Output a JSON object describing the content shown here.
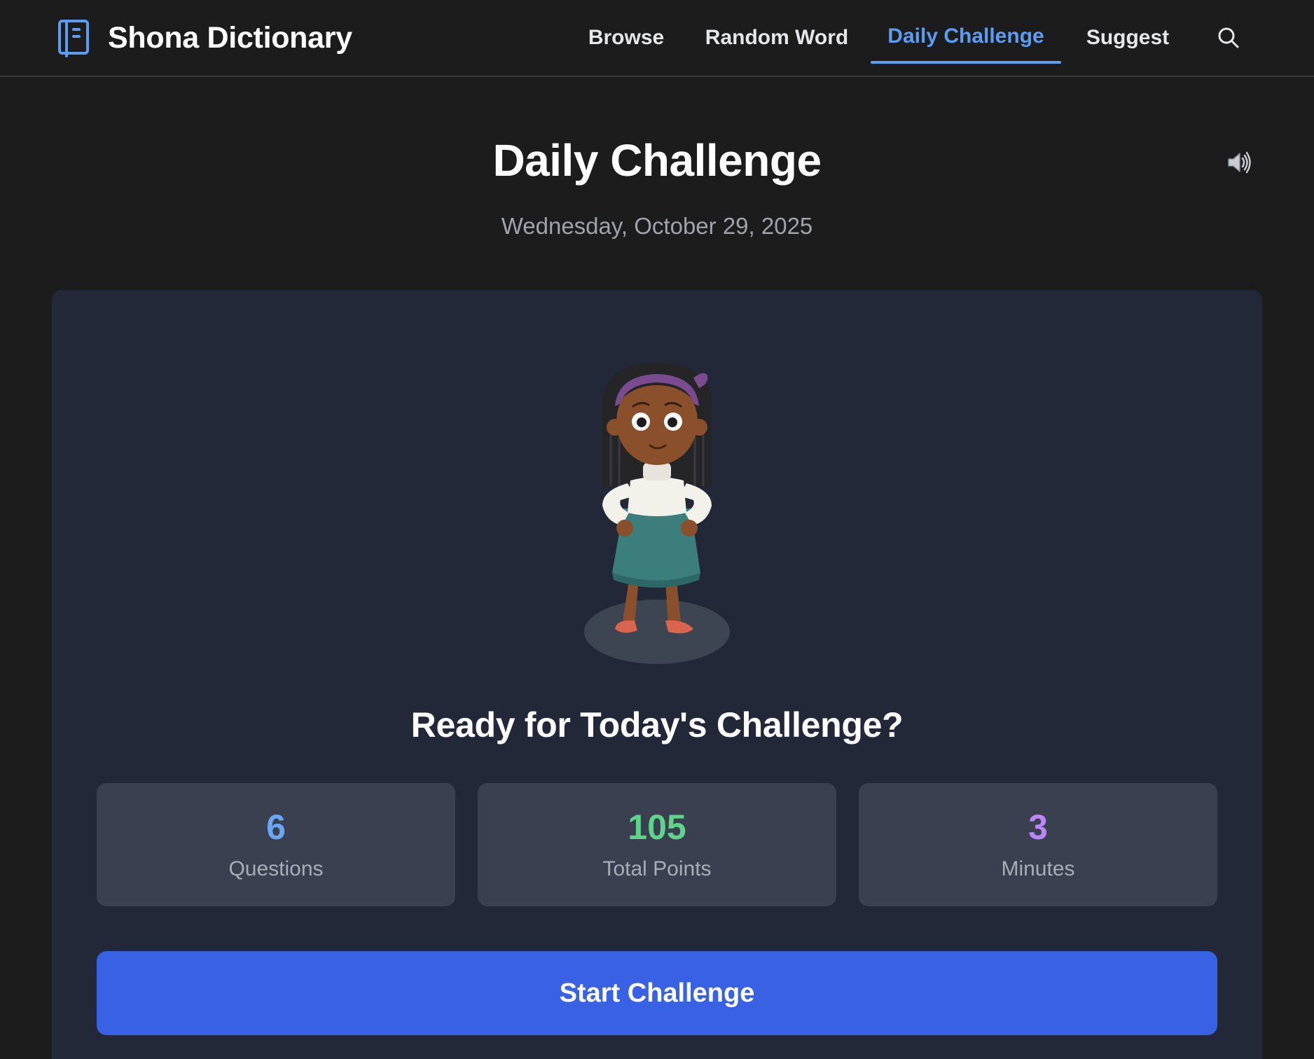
{
  "header": {
    "brand_title": "Shona Dictionary",
    "brand_icon": "book-icon",
    "nav": [
      {
        "label": "Browse",
        "active": false
      },
      {
        "label": "Random Word",
        "active": false
      },
      {
        "label": "Daily Challenge",
        "active": true
      },
      {
        "label": "Suggest",
        "active": false
      }
    ],
    "search_icon": "search-icon",
    "accent_color": "#5b9cf4"
  },
  "main": {
    "title": "Daily Challenge",
    "date": "Wednesday, October 29, 2025",
    "sound_icon": "speaker-icon",
    "mascot": "girl-character-illustration",
    "heading": "Ready for Today's Challenge?",
    "stats": [
      {
        "value": "6",
        "label": "Questions",
        "color": "#6ba6f5"
      },
      {
        "value": "105",
        "label": "Total Points",
        "color": "#5fd38a"
      },
      {
        "value": "3",
        "label": "Minutes",
        "color": "#bb86f5"
      }
    ],
    "start_button": "Start Challenge",
    "start_button_color": "#3862e3"
  }
}
